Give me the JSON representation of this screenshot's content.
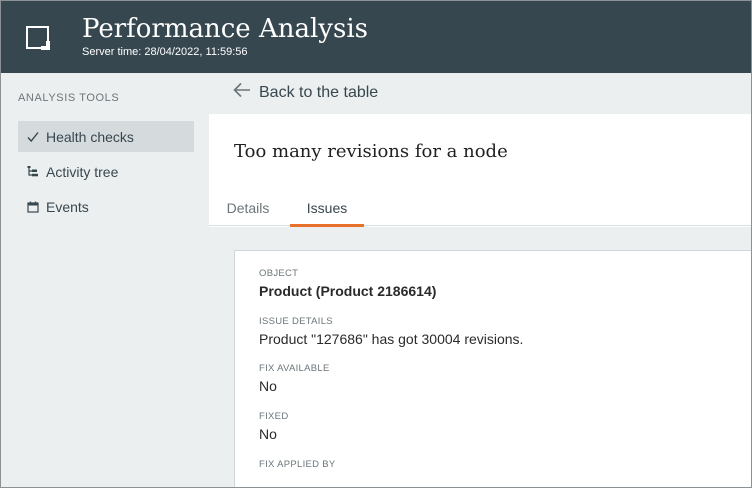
{
  "header": {
    "title": "Performance Analysis",
    "server_time": "Server time: 28/04/2022, 11:59:56",
    "icon": "window-square-icon",
    "bg_color": "#37474f"
  },
  "sidebar": {
    "section_label": "ANALYSIS TOOLS",
    "items": [
      {
        "label": "Health checks",
        "icon": "check-icon",
        "active": true
      },
      {
        "label": "Activity tree",
        "icon": "tree-icon",
        "active": false
      },
      {
        "label": "Events",
        "icon": "calendar-icon",
        "active": false
      }
    ]
  },
  "backbar": {
    "label": "Back to the table",
    "icon": "arrow-left-icon"
  },
  "main": {
    "title": "Too many revisions for a node",
    "tabs": [
      {
        "label": "Details",
        "active": false
      },
      {
        "label": "Issues",
        "active": true
      }
    ],
    "accent_color": "#e8702a",
    "issue": {
      "object_label": "OBJECT",
      "object_value": "Product (Product 2186614)",
      "details_label": "ISSUE DETAILS",
      "details_value": "Product \"127686\" has got 30004 revisions.",
      "fix_available_label": "FIX AVAILABLE",
      "fix_available_value": "No",
      "fixed_label": "FIXED",
      "fixed_value": "No",
      "fix_applied_by_label": "FIX APPLIED BY"
    }
  }
}
